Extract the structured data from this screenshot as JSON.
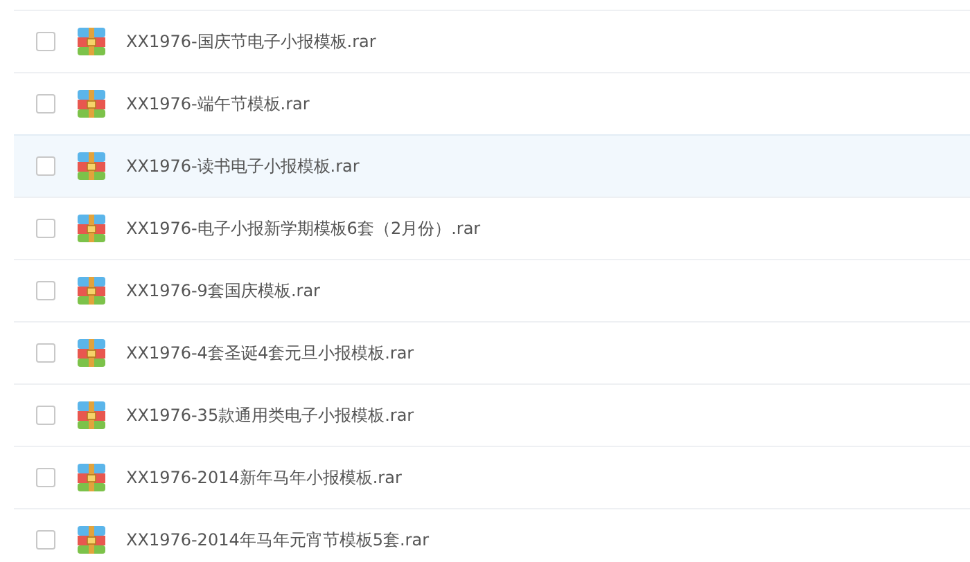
{
  "files": [
    {
      "name": "XX1976-国庆节电子小报模板.rar",
      "checked": false,
      "selected": false
    },
    {
      "name": "XX1976-端午节模板.rar",
      "checked": false,
      "selected": false
    },
    {
      "name": "XX1976-读书电子小报模板.rar",
      "checked": false,
      "selected": true
    },
    {
      "name": "XX1976-电子小报新学期模板6套（2月份）.rar",
      "checked": false,
      "selected": false
    },
    {
      "name": "XX1976-9套国庆模板.rar",
      "checked": false,
      "selected": false
    },
    {
      "name": "XX1976-4套圣诞4套元旦小报模板.rar",
      "checked": false,
      "selected": false
    },
    {
      "name": "XX1976-35款通用类电子小报模板.rar",
      "checked": false,
      "selected": false
    },
    {
      "name": "XX1976-2014新年马年小报模板.rar",
      "checked": false,
      "selected": false
    },
    {
      "name": "XX1976-2014年马年元宵节模板5套.rar",
      "checked": false,
      "selected": false
    }
  ]
}
